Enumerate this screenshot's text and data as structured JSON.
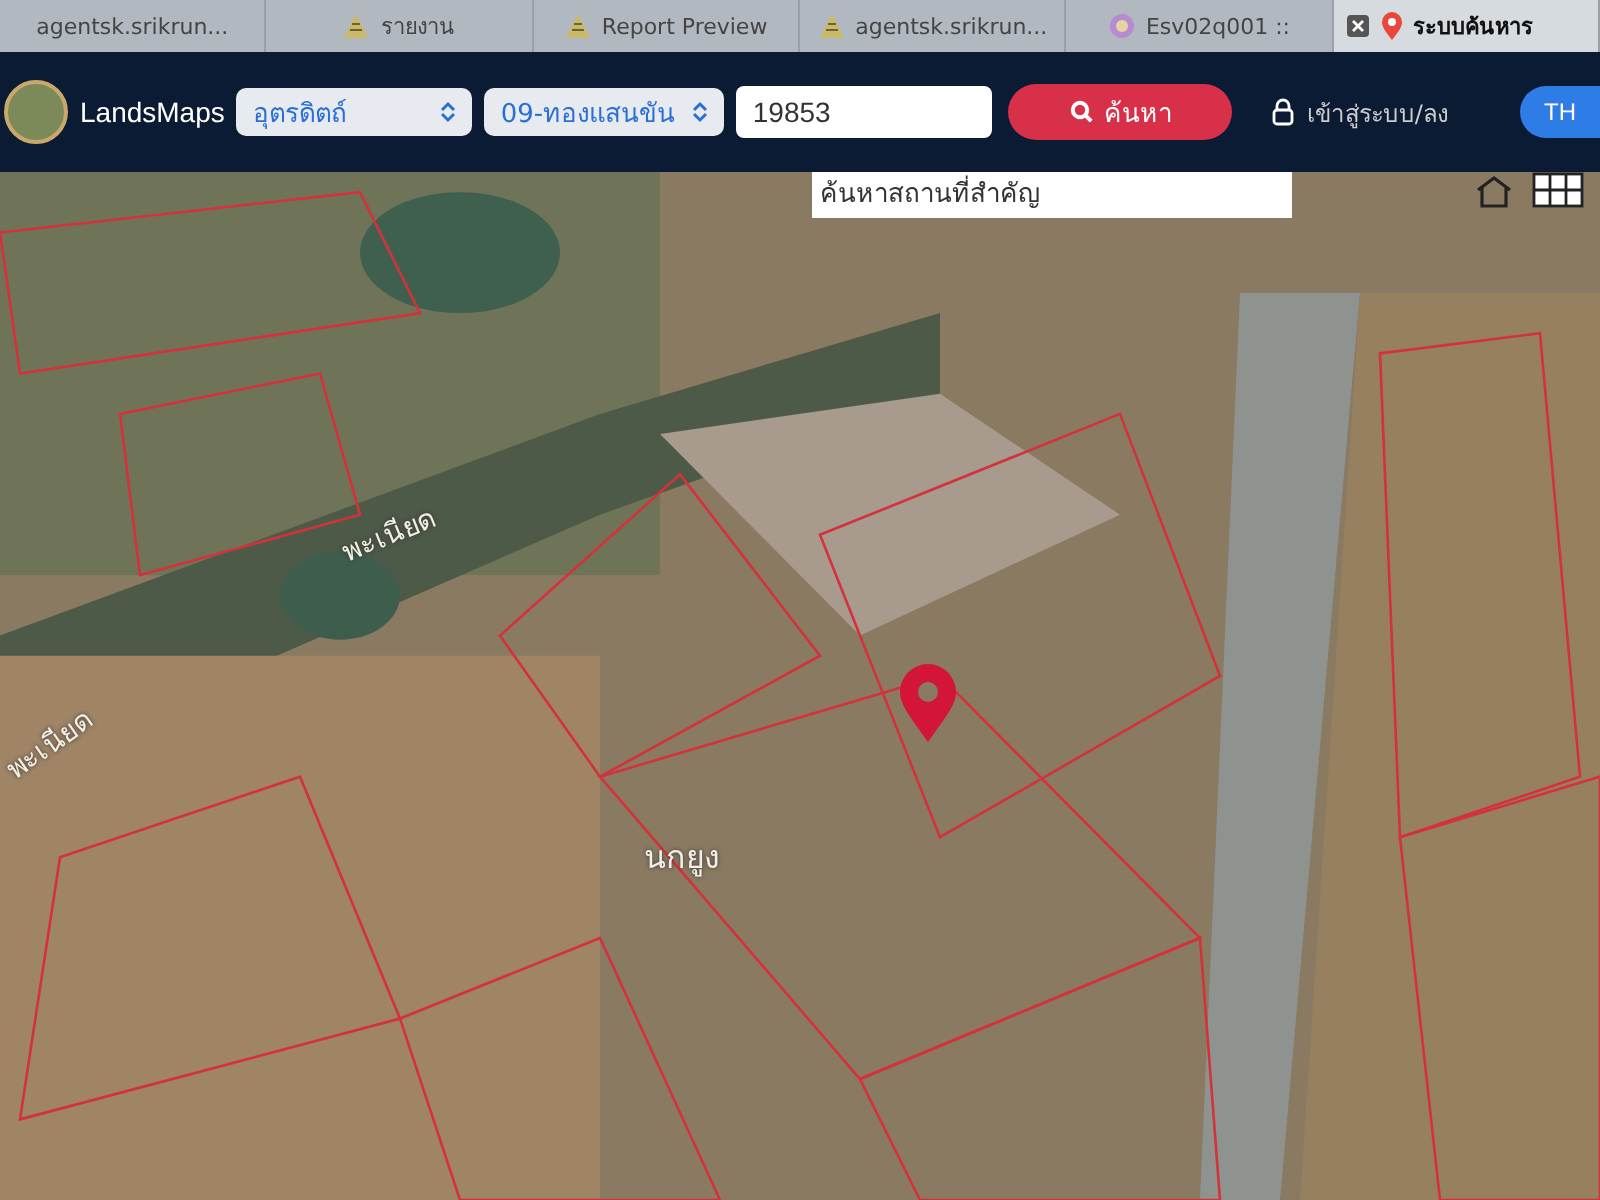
{
  "browser_tabs": [
    {
      "title": "agentsk.srikrun...",
      "selected": false
    },
    {
      "title": "รายงาน",
      "selected": false
    },
    {
      "title": "Report Preview",
      "selected": false
    },
    {
      "title": "agentsk.srikrun...",
      "selected": false
    },
    {
      "title": "Esv02q001 ::",
      "selected": false
    },
    {
      "title": "ระบบค้นหาร",
      "selected": true
    }
  ],
  "header": {
    "brand": "LandsMaps",
    "province": "อุตรดิตถ์",
    "district": "09-ทองแสนขัน",
    "parcel_number": "19853",
    "search_button": "ค้นหา",
    "login": "เข้าสู่ระบบ/ลง",
    "language": "TH"
  },
  "map": {
    "place_search": {
      "placeholder": "ค้นหาสถานที่สำคัญ"
    },
    "labels": [
      {
        "text": "พะเนียด",
        "kind": "river"
      },
      {
        "text": "พะเนียด",
        "kind": "river"
      },
      {
        "text": "นกยูง",
        "kind": "place"
      }
    ]
  }
}
